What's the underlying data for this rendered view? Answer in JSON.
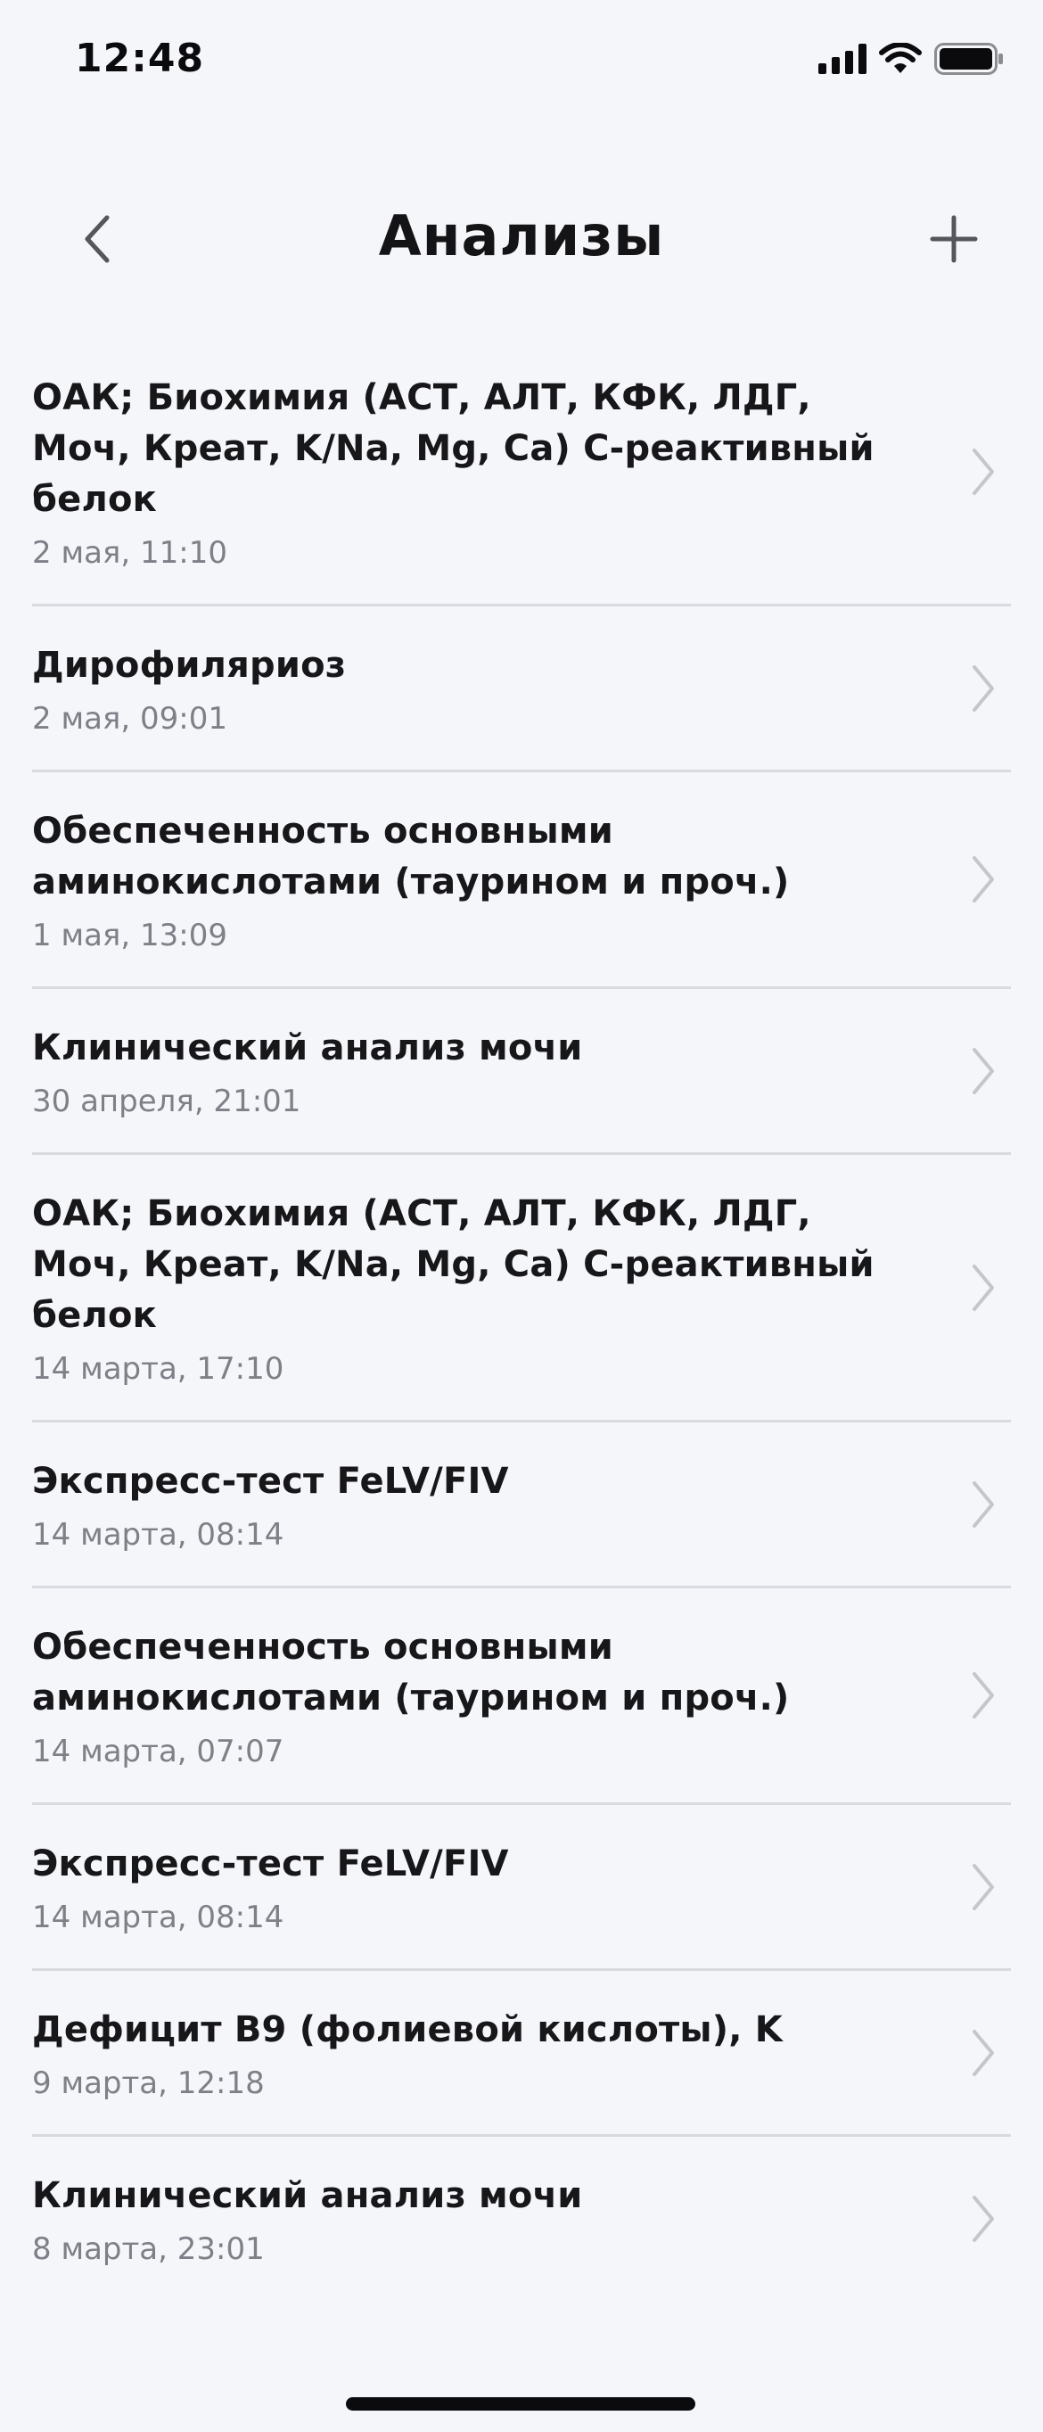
{
  "status_bar": {
    "time": "12:48"
  },
  "header": {
    "title": "Анализы",
    "back_icon": "chevron-left-icon",
    "add_icon": "plus-icon"
  },
  "items": [
    {
      "title": "ОАК; Биохимия (АСТ, АЛТ, КФК, ЛДГ, Моч, Креат, K/Na, Mg, Ca) С-реактивный белок",
      "date": "2 мая, 11:10"
    },
    {
      "title": "Дирофиляриоз",
      "date": "2 мая, 09:01"
    },
    {
      "title": "Обеспеченность основными аминокислотами (таурином и проч.)",
      "date": "1 мая, 13:09"
    },
    {
      "title": "Клинический анализ мочи",
      "date": "30 апреля, 21:01"
    },
    {
      "title": "ОАК; Биохимия (АСТ, АЛТ, КФК, ЛДГ, Моч, Креат, K/Na, Mg, Ca) С-реактивный белок",
      "date": "14 марта, 17:10"
    },
    {
      "title": "Экспресс-тест FeLV/FIV",
      "date": "14 марта, 08:14"
    },
    {
      "title": "Обеспеченность основными аминокислотами (таурином и проч.)",
      "date": "14 марта, 07:07"
    },
    {
      "title": "Экспресс-тест FeLV/FIV",
      "date": "14 марта, 08:14"
    },
    {
      "title": "Дефицит B9 (фолиевой кислоты), K",
      "date": "9 марта, 12:18"
    },
    {
      "title": "Клинический анализ мочи",
      "date": "8 марта, 23:01"
    }
  ],
  "colors": {
    "background": "#F5F6FA",
    "text_primary": "#17171A",
    "text_secondary": "#7E8088",
    "divider": "#D9DAE0",
    "chevron": "#C5C6CC"
  }
}
